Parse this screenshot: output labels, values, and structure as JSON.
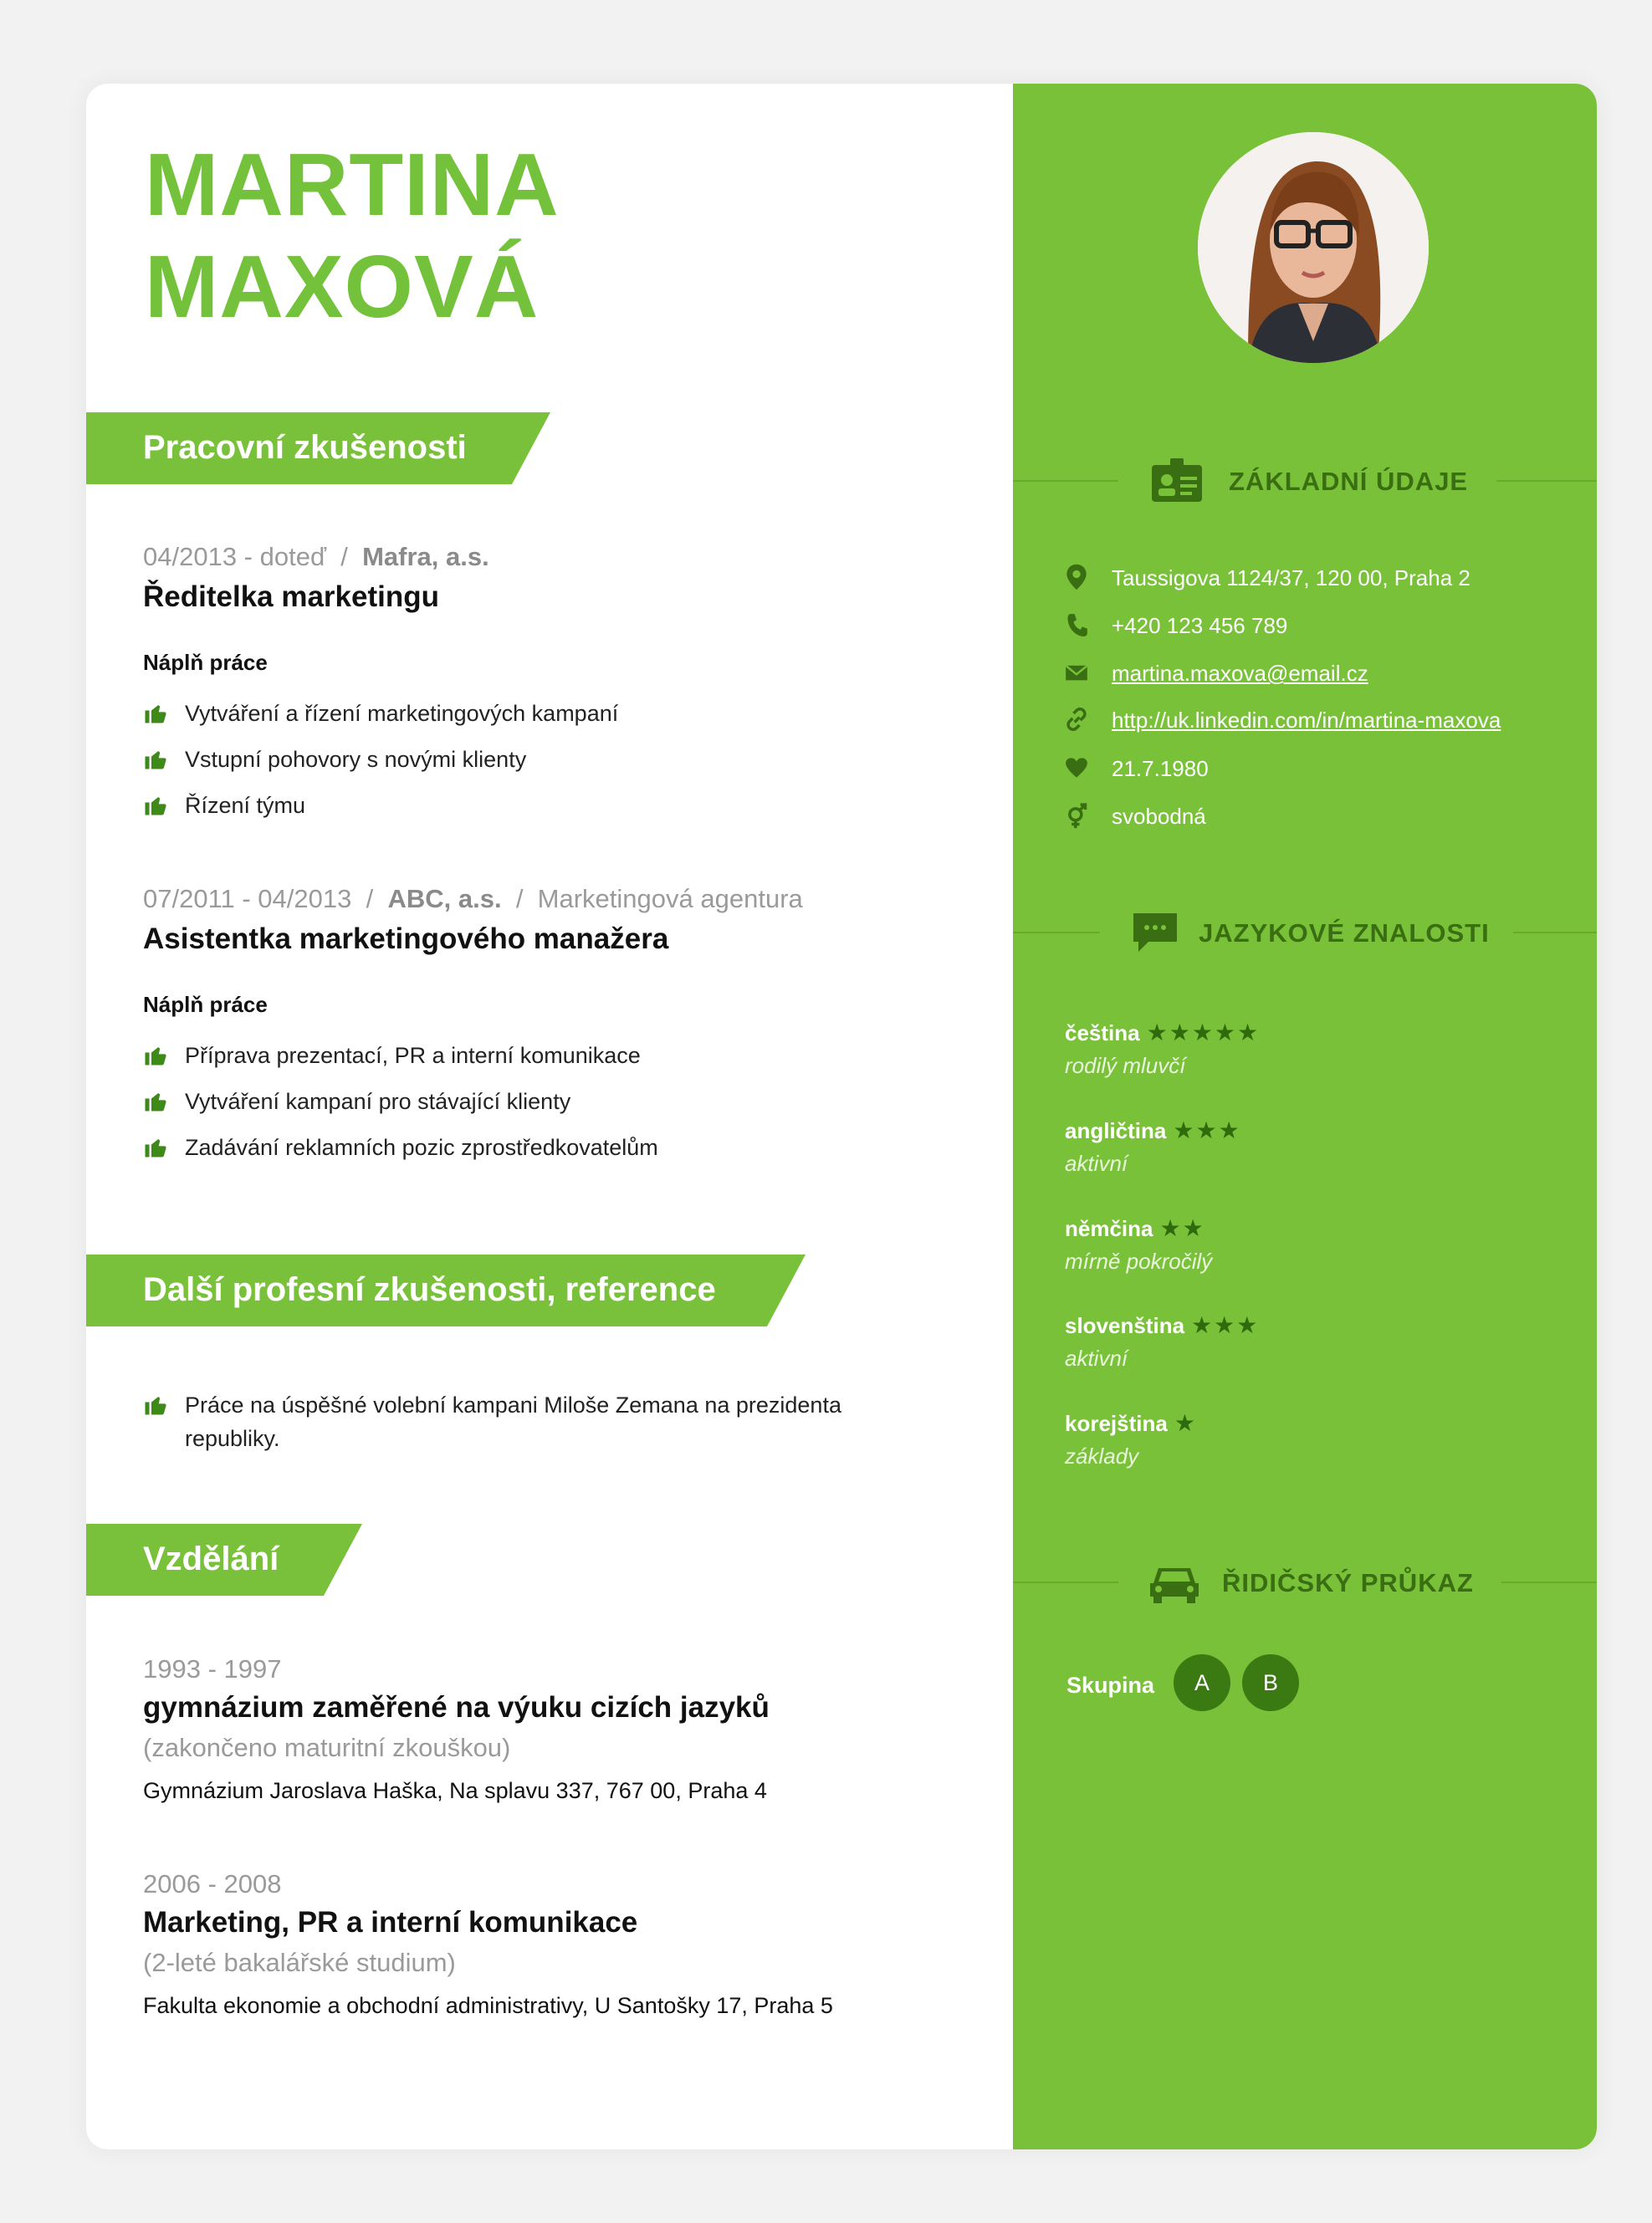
{
  "name": {
    "line1": "MARTINA",
    "line2": "MAXOVÁ"
  },
  "sections": {
    "work": "Pracovní zkušenosti",
    "other": "Další profesní zkušenosti, reference",
    "education": "Vzdělání"
  },
  "jobs": [
    {
      "period": "04/2013 - doteď",
      "sep": "/",
      "company": "Mafra, a.s.",
      "type": "",
      "title": "Ředitelka marketingu",
      "duties_label": "Náplň práce",
      "duties": [
        "Vytváření a řízení marketingových kampaní",
        "Vstupní pohovory s novými klienty",
        "Řízení týmu"
      ]
    },
    {
      "period": "07/2011 - 04/2013",
      "sep": "/",
      "company": "ABC, a.s.",
      "type": "Marketingová agentura",
      "title": "Asistentka marketingového manažera",
      "duties_label": "Náplň práce",
      "duties": [
        "Příprava prezentací, PR a interní komunikace",
        "Vytváření kampaní pro stávající klienty",
        "Zadávání reklamních pozic zprostředkovatelům"
      ]
    }
  ],
  "other_items": [
    "Práce na úspěšné volební kampani Miloše Zemana na prezidenta republiky."
  ],
  "education": [
    {
      "period": "1993 - 1997",
      "title": "gymnázium zaměřené na výuku cizích jazyků",
      "note": "(zakončeno maturitní zkouškou)",
      "institution": "Gymnázium Jaroslava Haška, Na splavu 337, 767 00, Praha 4"
    },
    {
      "period": "2006 - 2008",
      "title": "Marketing, PR a interní komunikace",
      "note": "(2-leté bakalářské studium)",
      "institution": "Fakulta ekonomie a obchodní administrativy, U Santošky 17, Praha 5"
    }
  ],
  "sidebar": {
    "basic_title": "ZÁKLADNÍ ÚDAJE",
    "contacts": {
      "address": "Taussigova 1124/37, 120 00, Praha 2",
      "phone": "+420 123 456 789",
      "email": "martina.maxova@email.cz",
      "web": "http://uk.linkedin.com/in/martina-maxova",
      "birth": "21.7.1980",
      "status": "svobodná"
    },
    "languages_title": "JAZYKOVÉ ZNALOSTI",
    "languages": [
      {
        "name": "čeština",
        "stars": 5,
        "level": "rodilý mluvčí"
      },
      {
        "name": "angličtina",
        "stars": 3,
        "level": "aktivní"
      },
      {
        "name": "němčina",
        "stars": 2,
        "level": "mírně pokročilý"
      },
      {
        "name": "slovenština",
        "stars": 3,
        "level": "aktivní"
      },
      {
        "name": "korejština",
        "stars": 1,
        "level": "základy"
      }
    ],
    "license_title": "ŘIDIČSKÝ PRŮKAZ",
    "license_label": "Skupina",
    "license_groups": [
      "A",
      "B"
    ]
  },
  "colors": {
    "accent": "#79c13a",
    "dark_green": "#3b7a12"
  }
}
